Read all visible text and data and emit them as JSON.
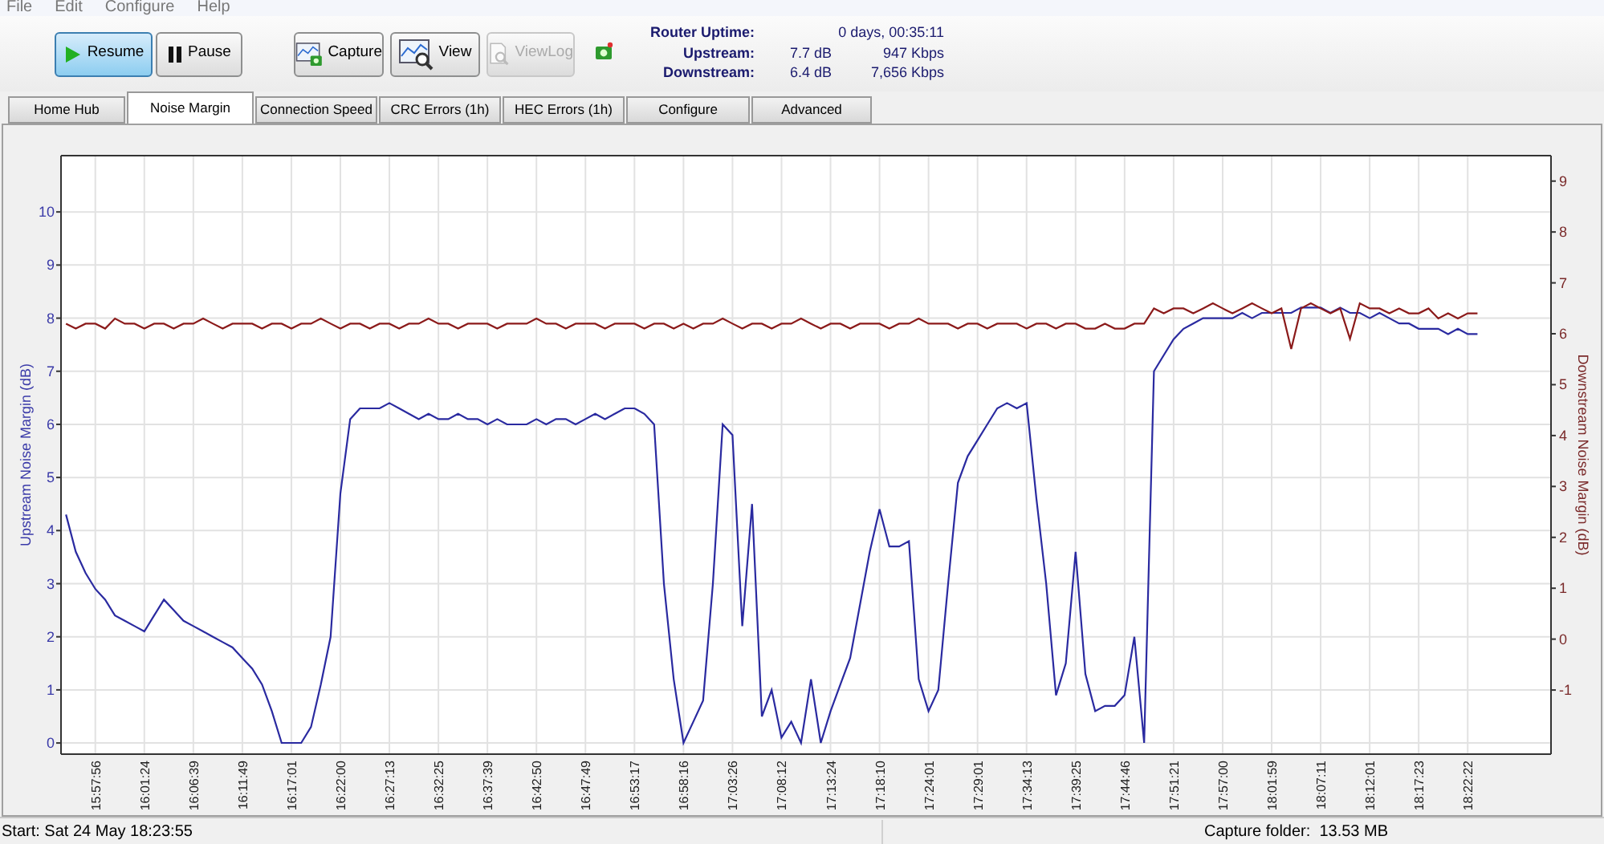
{
  "menu": [
    "File",
    "Edit",
    "Configure",
    "Help"
  ],
  "toolbar": {
    "buttons": [
      {
        "label": "Resume",
        "selected": true,
        "disabled": false
      },
      {
        "label": "Pause",
        "selected": false,
        "disabled": false
      },
      {
        "label": "Capture",
        "selected": false,
        "disabled": false
      },
      {
        "label": "View",
        "selected": false,
        "disabled": false
      },
      {
        "label": "ViewLog",
        "selected": false,
        "disabled": true
      }
    ]
  },
  "router_info": {
    "rows": [
      {
        "label": "Router Uptime:",
        "value_1": "",
        "value_2": "0 days, 00:35:11"
      },
      {
        "label": "Upstream:",
        "value_1": "7.7 dB",
        "value_2": "947 Kbps"
      },
      {
        "label": "Downstream:",
        "value_1": "6.4 dB",
        "value_2": "7,656 Kbps"
      }
    ]
  },
  "tabs": [
    {
      "label": "Home Hub",
      "selected": false
    },
    {
      "label": "Noise Margin",
      "selected": true
    },
    {
      "label": "Connection Speed",
      "selected": false
    },
    {
      "label": "CRC Errors (1h)",
      "selected": false
    },
    {
      "label": "HEC Errors (1h)",
      "selected": false
    },
    {
      "label": "Configure",
      "selected": false
    },
    {
      "label": "Advanced",
      "selected": false
    }
  ],
  "chart_data": {
    "type": "line",
    "grid": true,
    "ylabel": "Upstream Noise Margin (dB)",
    "y2label": "Downstream Noise Margin (dB)",
    "categories": [
      null,
      null,
      null,
      "15:57:56",
      null,
      null,
      null,
      null,
      "16:01:24",
      null,
      null,
      null,
      null,
      "16:06:39",
      null,
      null,
      null,
      null,
      "16:11:49",
      null,
      null,
      null,
      null,
      "16:17:01",
      null,
      null,
      null,
      null,
      "16:22:00",
      null,
      null,
      null,
      null,
      "16:27:13",
      null,
      null,
      null,
      null,
      "16:32:25",
      null,
      null,
      null,
      null,
      "16:37:39",
      null,
      null,
      null,
      null,
      "16:42:50",
      null,
      null,
      null,
      null,
      "16:47:49",
      null,
      null,
      null,
      null,
      "16:53:17",
      null,
      null,
      null,
      null,
      "16:58:16",
      null,
      null,
      null,
      null,
      "17:03:26",
      null,
      null,
      null,
      null,
      "17:08:12",
      null,
      null,
      null,
      null,
      "17:13:24",
      null,
      null,
      null,
      null,
      "17:18:10",
      null,
      null,
      null,
      null,
      "17:24:01",
      null,
      null,
      null,
      null,
      "17:29:01",
      null,
      null,
      null,
      null,
      "17:34:13",
      null,
      null,
      null,
      null,
      "17:39:25",
      null,
      null,
      null,
      null,
      "17:44:46",
      null,
      null,
      null,
      null,
      "17:51:21",
      null,
      null,
      null,
      null,
      "17:57:00",
      null,
      null,
      null,
      null,
      "18:01:59",
      null,
      null,
      null,
      null,
      "18:07:11",
      null,
      null,
      null,
      null,
      "18:12:01",
      null,
      null,
      null,
      null,
      "18:17:23",
      null,
      null,
      null,
      null,
      "18:22:22",
      null,
      null,
      null,
      null,
      null,
      null,
      null,
      null
    ],
    "series": [
      {
        "color": "#2a2aa0",
        "values": [
          4.3,
          3.6,
          3.2,
          2.9,
          2.7,
          2.4,
          2.3,
          2.2,
          2.1,
          2.4,
          2.7,
          2.5,
          2.3,
          2.2,
          2.1,
          2.0,
          1.9,
          1.8,
          1.6,
          1.4,
          1.1,
          0.6,
          0,
          0,
          0,
          0.3,
          1.1,
          2.0,
          4.7,
          6.1,
          6.3,
          6.3,
          6.3,
          6.4,
          6.3,
          6.2,
          6.1,
          6.2,
          6.1,
          6.1,
          6.2,
          6.1,
          6.1,
          6.0,
          6.1,
          6.0,
          6.0,
          6.0,
          6.1,
          6.0,
          6.1,
          6.1,
          6.0,
          6.1,
          6.2,
          6.1,
          6.2,
          6.3,
          6.3,
          6.2,
          6.0,
          3.0,
          1.2,
          0,
          0.4,
          0.8,
          3.0,
          6.0,
          5.8,
          2.2,
          4.5,
          0.5,
          1.0,
          0.1,
          0.4,
          0,
          1.2,
          0,
          0.6,
          1.1,
          1.6,
          2.6,
          3.6,
          4.4,
          3.7,
          3.7,
          3.8,
          1.2,
          0.6,
          1.0,
          3.0,
          4.9,
          5.4,
          5.7,
          6.0,
          6.3,
          6.4,
          6.3,
          6.4,
          4.6,
          3.0,
          0.9,
          1.5,
          3.6,
          1.3,
          0.6,
          0.7,
          0.7,
          0.9,
          2.0,
          0,
          7.0,
          7.3,
          7.6,
          7.8,
          7.9,
          8.0,
          8.0,
          8.0,
          8.0,
          8.1,
          8.0,
          8.1,
          8.1,
          8.1,
          8.1,
          8.2,
          8.2,
          8.2,
          8.1,
          8.2,
          8.1,
          8.1,
          8.0,
          8.1,
          8.0,
          7.9,
          7.9,
          7.8,
          7.8,
          7.8,
          7.7,
          7.8,
          7.7,
          7.7,
          null,
          null,
          null,
          null,
          null,
          null,
          null
        ]
      },
      {
        "color": "#8b1a1a",
        "axis": "y2",
        "values": [
          6.2,
          6.1,
          6.2,
          6.2,
          6.1,
          6.3,
          6.2,
          6.2,
          6.1,
          6.2,
          6.2,
          6.1,
          6.2,
          6.2,
          6.3,
          6.2,
          6.1,
          6.2,
          6.2,
          6.2,
          6.1,
          6.2,
          6.2,
          6.1,
          6.2,
          6.2,
          6.3,
          6.2,
          6.1,
          6.2,
          6.2,
          6.1,
          6.2,
          6.2,
          6.1,
          6.2,
          6.2,
          6.3,
          6.2,
          6.2,
          6.1,
          6.2,
          6.2,
          6.2,
          6.1,
          6.2,
          6.2,
          6.2,
          6.3,
          6.2,
          6.2,
          6.1,
          6.2,
          6.2,
          6.2,
          6.1,
          6.2,
          6.2,
          6.2,
          6.1,
          6.2,
          6.2,
          6.1,
          6.2,
          6.1,
          6.2,
          6.2,
          6.3,
          6.2,
          6.1,
          6.2,
          6.2,
          6.1,
          6.2,
          6.2,
          6.3,
          6.2,
          6.1,
          6.2,
          6.2,
          6.1,
          6.2,
          6.2,
          6.2,
          6.1,
          6.2,
          6.2,
          6.3,
          6.2,
          6.2,
          6.2,
          6.1,
          6.2,
          6.2,
          6.1,
          6.2,
          6.2,
          6.2,
          6.1,
          6.2,
          6.2,
          6.1,
          6.2,
          6.2,
          6.1,
          6.1,
          6.2,
          6.1,
          6.1,
          6.2,
          6.2,
          6.5,
          6.4,
          6.5,
          6.5,
          6.4,
          6.5,
          6.6,
          6.5,
          6.4,
          6.5,
          6.6,
          6.5,
          6.4,
          6.5,
          5.7,
          6.5,
          6.6,
          6.5,
          6.4,
          6.5,
          5.9,
          6.6,
          6.5,
          6.5,
          6.4,
          6.5,
          6.4,
          6.4,
          6.5,
          6.3,
          6.4,
          6.3,
          6.4,
          6.4,
          null,
          null,
          null,
          null,
          null,
          null,
          null
        ]
      }
    ],
    "ylim": [
      -0.21,
      11.06
    ],
    "y2lim": [
      -2.26,
      9.5
    ],
    "yticks": [
      0,
      1,
      2,
      3,
      4,
      5,
      6,
      7,
      8,
      9,
      10
    ],
    "y2ticks": [
      -1,
      0,
      1,
      2,
      3,
      4,
      5,
      6,
      7,
      8,
      9
    ]
  },
  "status_bar": {
    "start": "Start: Sat 24 May 18:23:55",
    "capture_folder": "Capture folder:  13.53 MB"
  }
}
